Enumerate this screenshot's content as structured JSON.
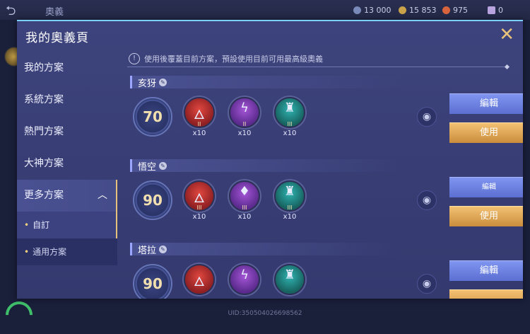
{
  "background": {
    "title": "奧義",
    "currencies": [
      {
        "value": "13 000",
        "color": "#7a8ab8"
      },
      {
        "value": "15 853",
        "color": "#c9a24a"
      },
      {
        "value": "975",
        "color": "#d8643e"
      },
      {
        "value": "0",
        "color": "#b9a4e0"
      }
    ],
    "uid": "UID:350504026698562"
  },
  "dialog": {
    "title": "我的奧義頁",
    "close_icon": "✕"
  },
  "sidebar": {
    "items": [
      {
        "label": "我的方案"
      },
      {
        "label": "系統方案"
      },
      {
        "label": "熱門方案"
      },
      {
        "label": "大神方案"
      },
      {
        "label": "更多方案",
        "expanded": true
      }
    ],
    "subitems": [
      {
        "label": "自訂",
        "selected": true
      },
      {
        "label": "通用方案",
        "selected": false
      }
    ]
  },
  "notice": {
    "text": "使用後覆蓋目前方案，預設使用目前可用最高級奧義"
  },
  "plans": [
    {
      "name": "亥犽",
      "level": "70",
      "runes": [
        {
          "color": "red",
          "icon": "flame-icon",
          "glyph": "🜂",
          "tier": "II",
          "qty": "x10"
        },
        {
          "color": "purple",
          "icon": "lightning-icon",
          "glyph": "ϟ",
          "tier": "II",
          "qty": "x10"
        },
        {
          "color": "teal",
          "icon": "figure-icon",
          "glyph": "♜",
          "tier": "III",
          "qty": "x10"
        }
      ],
      "edit_label": "編輯",
      "use_label": "使用"
    },
    {
      "name": "悟空",
      "level": "90",
      "runes": [
        {
          "color": "red",
          "icon": "flame-icon",
          "glyph": "🜂",
          "tier": "III",
          "qty": "x10"
        },
        {
          "color": "purple",
          "icon": "drop-icon",
          "glyph": "♦",
          "tier": "III",
          "qty": "x10"
        },
        {
          "color": "teal",
          "icon": "figure-icon",
          "glyph": "♜",
          "tier": "III",
          "qty": "x10"
        }
      ],
      "edit_label": "編輯",
      "use_label": "使用"
    },
    {
      "name": "塔拉",
      "level": "90",
      "runes": [
        {
          "color": "red",
          "icon": "flame-icon",
          "glyph": "🜂",
          "tier": "",
          "qty": ""
        },
        {
          "color": "purple",
          "icon": "lightning-icon",
          "glyph": "ϟ",
          "tier": "",
          "qty": ""
        },
        {
          "color": "teal",
          "icon": "figure-icon",
          "glyph": "♜",
          "tier": "",
          "qty": ""
        }
      ],
      "edit_label": "編輯",
      "use_label": ""
    }
  ]
}
